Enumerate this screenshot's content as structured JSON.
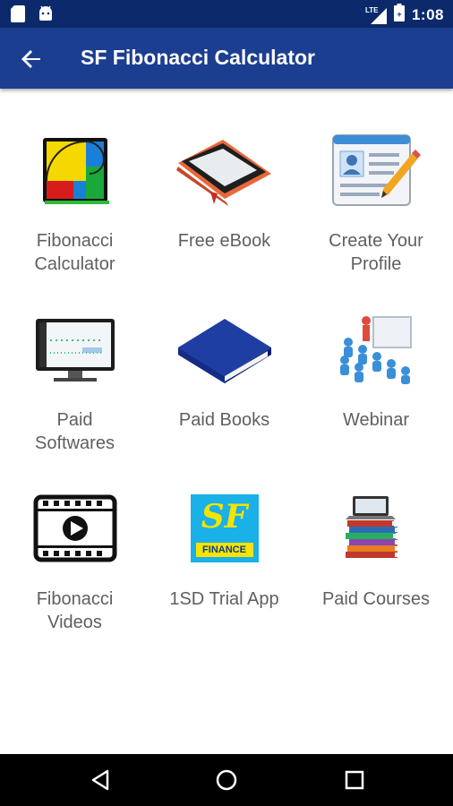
{
  "status_bar": {
    "time": "1:08",
    "network": "LTE",
    "icons": [
      "sd-card-icon",
      "android-icon",
      "lte-signal-icon",
      "battery-icon"
    ]
  },
  "toolbar": {
    "title": "SF Fibonacci Calculator",
    "back_icon": "arrow-left-icon"
  },
  "menu": {
    "items": [
      {
        "label": "Fibonacci\nCalculator",
        "icon": "fibonacci-spiral-icon"
      },
      {
        "label": "Free eBook",
        "icon": "ereader-icon"
      },
      {
        "label": "Create Your\nProfile",
        "icon": "profile-form-icon"
      },
      {
        "label": "Paid\nSoftwares",
        "icon": "monitor-software-icon"
      },
      {
        "label": "Paid Books",
        "icon": "blue-book-icon"
      },
      {
        "label": "Webinar",
        "icon": "webinar-audience-icon"
      },
      {
        "label": "Fibonacci\nVideos",
        "icon": "video-film-icon"
      },
      {
        "label": "1SD Trial App",
        "icon": "sf-finance-logo-icon",
        "logo_text_top": "SF",
        "logo_text_bottom": "FINANCE"
      },
      {
        "label": "Paid Courses",
        "icon": "books-laptop-icon"
      }
    ]
  },
  "nav_bar": {
    "buttons": [
      "back-triangle-icon",
      "home-circle-icon",
      "recents-square-icon"
    ]
  },
  "colors": {
    "status_bar": "#0c2a6b",
    "toolbar": "#1b3e90",
    "label_text": "#5f5f5f",
    "nav_bar": "#000000"
  }
}
